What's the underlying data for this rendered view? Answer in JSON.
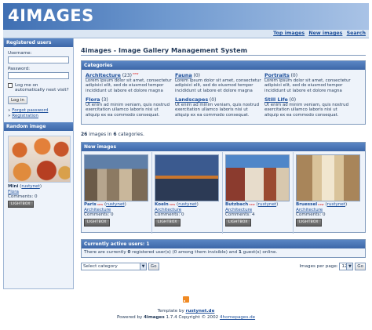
{
  "site": {
    "logo": "4IMAGES"
  },
  "toplinks": [
    "Top images",
    "New images",
    "Search"
  ],
  "sidebar": {
    "login_head": "Registered users",
    "username_label": "Username:",
    "password_label": "Password:",
    "remember_label": "Log me on automatically next visit?",
    "login_button": "Log in",
    "forgot_link": "Forgot password",
    "register_link": "Registration",
    "random_head": "Random image",
    "random": {
      "title": "Mini",
      "user": "rustynet",
      "category": "Flora",
      "comments": "Comments: 0",
      "lightbox": "LIGHTBOX"
    }
  },
  "main": {
    "title": "4images - Image Gallery Management System",
    "categories_head": "Categories",
    "categories": [
      {
        "name": "Architecture",
        "count": "(23)",
        "new": "new",
        "desc": "Lorem ipsum dolor sit amet, consectetur adipisici elit, sed do eiusmod tempor incididunt ut labore et dolore magna"
      },
      {
        "name": "Fauna",
        "count": "(0)",
        "new": "",
        "desc": "Lorem ipsum dolor sit amet, consectetur adipisici elit, sed do eiusmod tempor incididunt ut labore et dolore magna"
      },
      {
        "name": "Portraits",
        "count": "(0)",
        "new": "",
        "desc": "Lorem ipsum dolor sit amet, consectetur adipisici elit, sed do eiusmod tempor incididunt ut labore et dolore magna"
      },
      {
        "name": "Flora",
        "count": "(3)",
        "new": "",
        "desc": "Ut enim ad minim veniam, quis nostrud exercitation ullamco laboris nisi ut aliquip ex ea commodo consequat."
      },
      {
        "name": "Landscapes",
        "count": "(0)",
        "new": "",
        "desc": "Ut enim ad minim veniam, quis nostrud exercitation ullamco laboris nisi ut aliquip ex ea commodo consequat."
      },
      {
        "name": "Still Life",
        "count": "(0)",
        "new": "",
        "desc": "Ut enim ad minim veniam, quis nostrud exercitation ullamco laboris nisi ut aliquip ex ea commodo consequat."
      }
    ],
    "summary_images": "26",
    "summary_mid": "images in",
    "summary_cats": "6",
    "summary_end": "categories.",
    "new_images_head": "New images",
    "new_images": [
      {
        "title": "Paris",
        "new": "new",
        "user": "rustynet",
        "category": "Architecture",
        "comments": "Comments: 0",
        "lightbox": "LIGHTBOX"
      },
      {
        "title": "Koeln",
        "new": "new",
        "user": "rustynet",
        "category": "Architecture",
        "comments": "Comments: 0",
        "lightbox": "LIGHTBOX"
      },
      {
        "title": "Butzbach",
        "new": "new",
        "user": "rustynet",
        "category": "Architecture",
        "comments": "Comments: 4",
        "lightbox": "LIGHTBOX"
      },
      {
        "title": "Bruessel",
        "new": "new",
        "user": "rustynet",
        "category": "Architecture",
        "comments": "Comments: 0",
        "lightbox": "LIGHTBOX"
      }
    ],
    "active_head": "Currently active users: 1",
    "active_pre": "There are currently",
    "active_registered": "0",
    "active_mid": "registered user(s) (0 among them invisible) and",
    "active_guests": "1",
    "active_end": "guest(s) online.",
    "select_category": "Select category",
    "go": "Go",
    "per_page_label": "Images per page:",
    "per_page_value": "12"
  },
  "footer": {
    "template_pre": "Template by",
    "template_by": "rustynet.de",
    "powered_pre": "Powered by",
    "powered_app": "4images",
    "powered_rest": "1.7.4 Copyright © 2002",
    "powered_link": "4homepages.de"
  }
}
